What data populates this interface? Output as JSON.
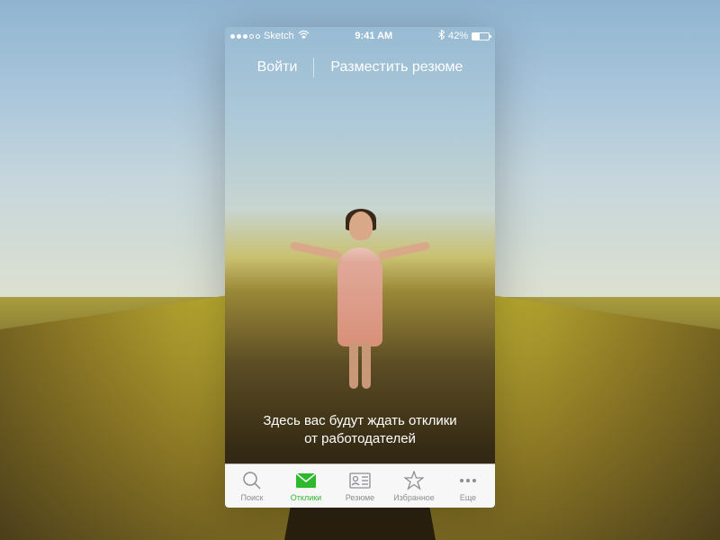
{
  "status_bar": {
    "carrier": "Sketch",
    "time": "9:41 AM",
    "battery_pct": "42%"
  },
  "nav": {
    "login": "Войти",
    "post_resume": "Разместить резюме"
  },
  "empty_state": {
    "line1": "Здесь вас будут ждать отклики",
    "line2": "от работодателей"
  },
  "tabs": {
    "search": "Поиск",
    "responses": "Отклики",
    "resumes": "Резюме",
    "favorites": "Избранное",
    "more": "Еще"
  },
  "active_tab": "responses"
}
